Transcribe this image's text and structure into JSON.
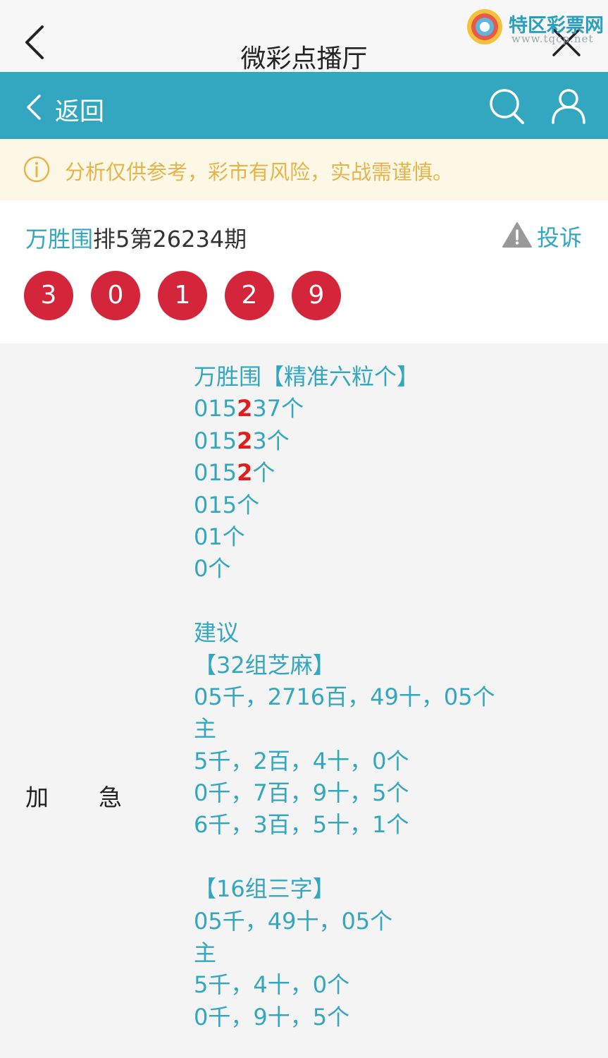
{
  "titlebar": {
    "title": "微彩点播厅"
  },
  "logo": {
    "name": "特区彩票网",
    "url": "www.tqcp.net"
  },
  "nav": {
    "back_label": "返回"
  },
  "notice": {
    "text": "分析仅供参考，彩市有风险，实战需谨慎。"
  },
  "info": {
    "author": "万胜围",
    "issue": "排5第26234期",
    "complain_label": "投诉",
    "balls": [
      "3",
      "0",
      "1",
      "2",
      "9"
    ]
  },
  "labels": {
    "left": "加",
    "right": "急"
  },
  "content": {
    "lines": [
      {
        "parts": [
          {
            "t": "万胜围【精准六粒个】",
            "hl": false
          }
        ]
      },
      {
        "parts": [
          {
            "t": "015",
            "hl": false
          },
          {
            "t": "2",
            "hl": true
          },
          {
            "t": "37个",
            "hl": false
          }
        ]
      },
      {
        "parts": [
          {
            "t": "015",
            "hl": false
          },
          {
            "t": "2",
            "hl": true
          },
          {
            "t": "3个",
            "hl": false
          }
        ]
      },
      {
        "parts": [
          {
            "t": "015",
            "hl": false
          },
          {
            "t": "2",
            "hl": true
          },
          {
            "t": "个",
            "hl": false
          }
        ]
      },
      {
        "parts": [
          {
            "t": "015个",
            "hl": false
          }
        ]
      },
      {
        "parts": [
          {
            "t": "01个",
            "hl": false
          }
        ]
      },
      {
        "parts": [
          {
            "t": "0个",
            "hl": false
          }
        ]
      },
      {
        "parts": []
      },
      {
        "parts": [
          {
            "t": "建议",
            "hl": false
          }
        ]
      },
      {
        "parts": [
          {
            "t": "【32组芝麻】",
            "hl": false
          }
        ]
      },
      {
        "parts": [
          {
            "t": "05千，2716百，49十，05个",
            "hl": false
          }
        ]
      },
      {
        "parts": [
          {
            "t": "主",
            "hl": false
          }
        ]
      },
      {
        "parts": [
          {
            "t": "5千，2百，4十，0个",
            "hl": false
          }
        ]
      },
      {
        "parts": [
          {
            "t": "0千，7百，9十，5个",
            "hl": false
          }
        ]
      },
      {
        "parts": [
          {
            "t": "6千，3百，5十，1个",
            "hl": false
          }
        ]
      },
      {
        "parts": []
      },
      {
        "parts": [
          {
            "t": "【16组三字】",
            "hl": false
          }
        ]
      },
      {
        "parts": [
          {
            "t": "05千，49十，05个",
            "hl": false
          }
        ]
      },
      {
        "parts": [
          {
            "t": "主",
            "hl": false
          }
        ]
      },
      {
        "parts": [
          {
            "t": "5千，4十，0个",
            "hl": false
          }
        ]
      },
      {
        "parts": [
          {
            "t": "0千，9十，5个",
            "hl": false
          }
        ]
      }
    ]
  },
  "colors": {
    "accent": "#33a7bf",
    "ball": "#d4263a",
    "highlight": "#e01e1e",
    "notice_text": "#e6b44c"
  },
  "icons": [
    "back-icon",
    "close-icon",
    "chevron-left-icon",
    "search-icon",
    "user-icon",
    "info-icon",
    "warning-icon"
  ]
}
